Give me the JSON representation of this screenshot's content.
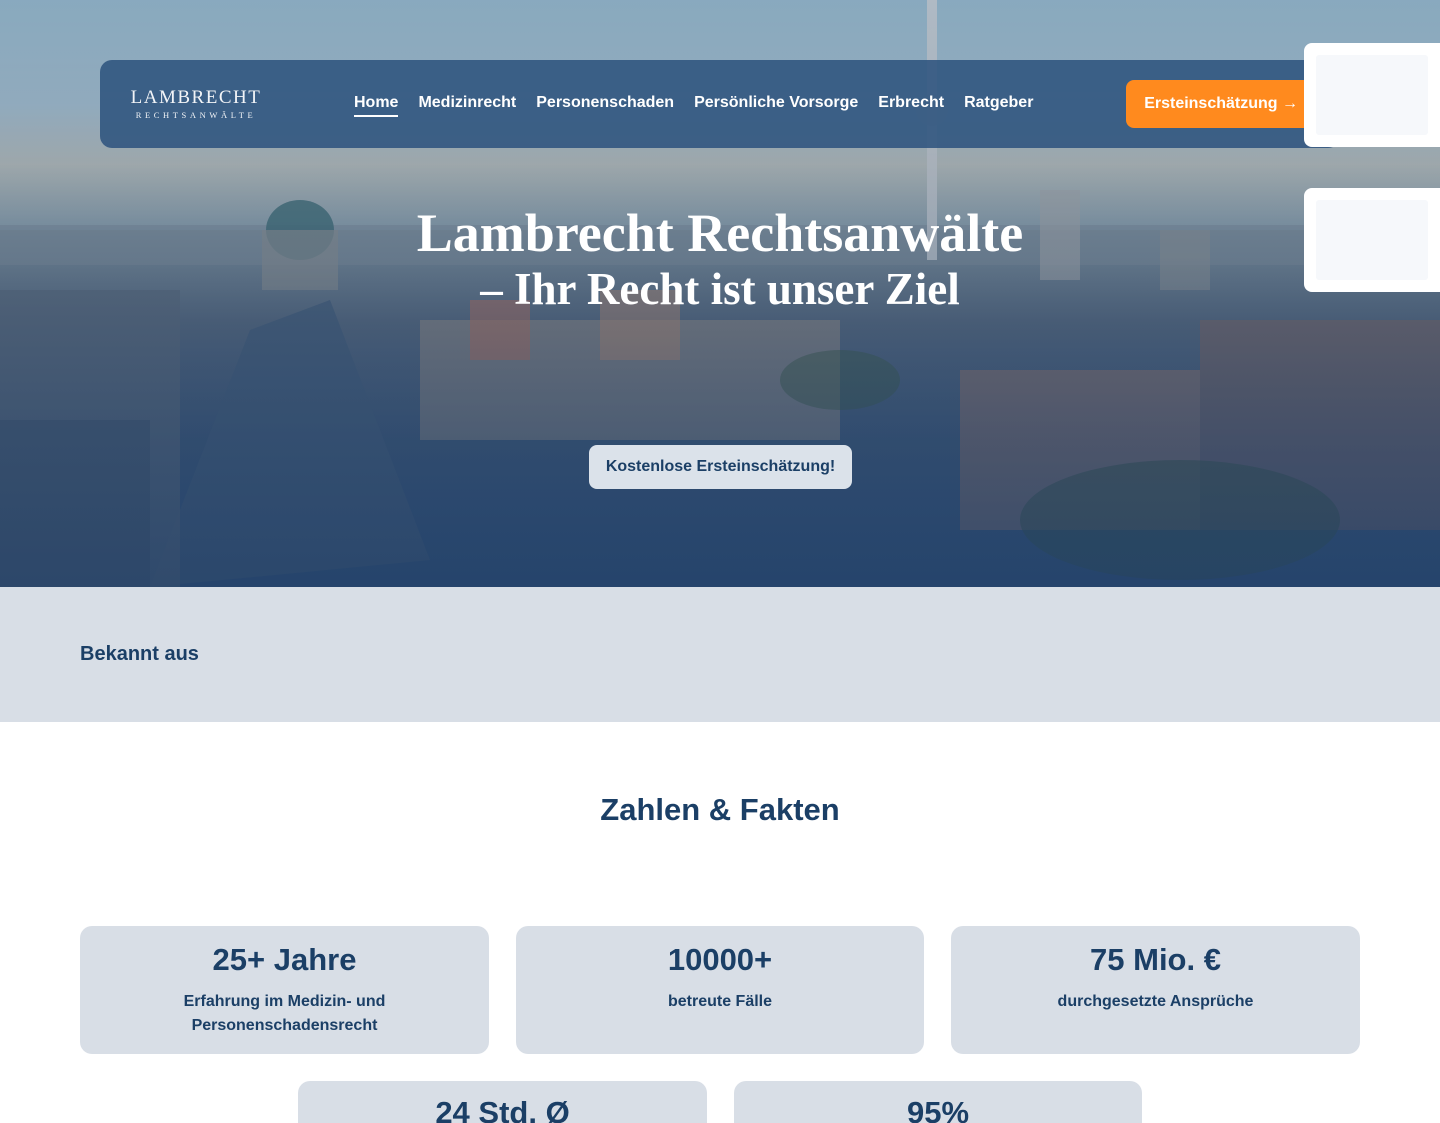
{
  "nav": {
    "logo": {
      "main": "LAMBRECHT",
      "sub": "RECHTSANWÄLTE"
    },
    "links": [
      {
        "label": "Home",
        "active": true
      },
      {
        "label": "Medizinrecht"
      },
      {
        "label": "Personenschaden"
      },
      {
        "label": "Persönliche Vorsorge"
      },
      {
        "label": "Erbrecht"
      },
      {
        "label": "Ratgeber"
      }
    ],
    "cta_label": "Ersteinschätzung →"
  },
  "hero": {
    "title_line1": "Lambrecht Rechtsanwälte",
    "title_line2": "– Ihr Recht ist unser Ziel",
    "button_label": "Kostenlose Ersteinschätzung!"
  },
  "known": {
    "heading": "Bekannt aus"
  },
  "facts": {
    "title": "Zahlen & Fakten",
    "items": [
      {
        "value": "25+ Jahre",
        "label": "Erfahrung im Medizin- und Personenschadensrecht"
      },
      {
        "value": "10000+",
        "label": "betreute Fälle"
      },
      {
        "value": "75 Mio. €",
        "label": "durchgesetzte Ansprüche"
      },
      {
        "value": "24 Std. Ø",
        "label": ""
      },
      {
        "value": "95%",
        "label": ""
      }
    ]
  },
  "colors": {
    "navy": "#1b3f66",
    "nav_bg": "#2f547e",
    "accent_orange": "#ff8a1e",
    "light_gray": "#d8dee6"
  }
}
